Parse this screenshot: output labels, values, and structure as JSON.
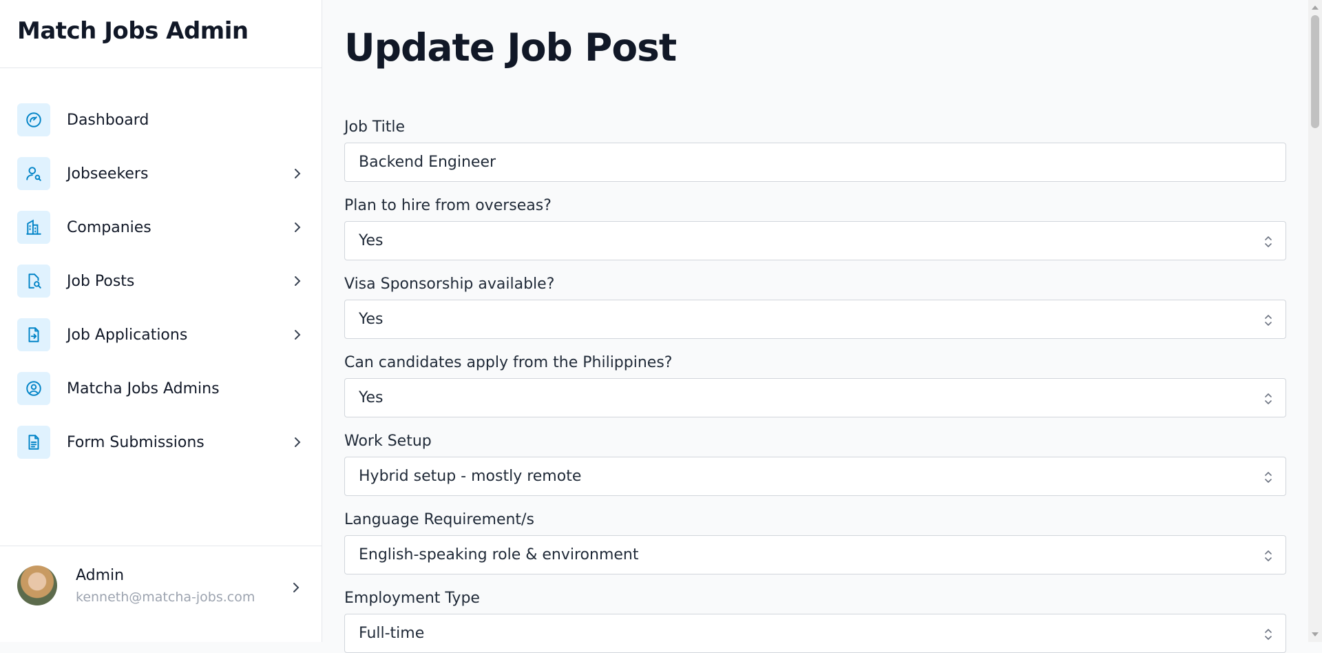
{
  "app": {
    "title": "Match Jobs Admin"
  },
  "sidebar": {
    "items": [
      {
        "label": "Dashboard",
        "icon": "dashboard-gauge-icon",
        "has_children": false
      },
      {
        "label": "Jobseekers",
        "icon": "user-search-icon",
        "has_children": true
      },
      {
        "label": "Companies",
        "icon": "building-icon",
        "has_children": true
      },
      {
        "label": "Job Posts",
        "icon": "document-search-icon",
        "has_children": true
      },
      {
        "label": "Job Applications",
        "icon": "document-arrow-icon",
        "has_children": true
      },
      {
        "label": "Matcha Jobs Admins",
        "icon": "user-circle-icon",
        "has_children": false
      },
      {
        "label": "Form Submissions",
        "icon": "document-text-icon",
        "has_children": true
      }
    ]
  },
  "user": {
    "name": "Admin",
    "email": "kenneth@matcha-jobs.com"
  },
  "page": {
    "title": "Update Job Post"
  },
  "form": {
    "fields": [
      {
        "label": "Job Title",
        "type": "text",
        "value": "Backend Engineer"
      },
      {
        "label": "Plan to hire from overseas?",
        "type": "select",
        "value": "Yes"
      },
      {
        "label": "Visa Sponsorship available?",
        "type": "select",
        "value": "Yes"
      },
      {
        "label": "Can candidates apply from the Philippines?",
        "type": "select",
        "value": "Yes"
      },
      {
        "label": "Work Setup",
        "type": "select",
        "value": "Hybrid setup - mostly remote"
      },
      {
        "label": "Language Requirement/s",
        "type": "select",
        "value": "English-speaking role & environment"
      },
      {
        "label": "Employment Type",
        "type": "select",
        "value": "Full-time"
      }
    ]
  },
  "colors": {
    "accent": "#0ea5e9",
    "icon_bg": "#e0f2fe"
  }
}
